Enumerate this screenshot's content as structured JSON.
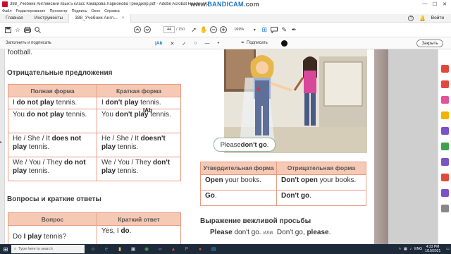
{
  "titlebar": {
    "title": "388_Учебник Английский язык 5 класс Комарова Ларионова Грейджер.pdf - Adobe Acrobat Reader DC",
    "watermark_pre": "www.",
    "watermark_brand": "BANDICAM",
    "watermark_post": ".com",
    "min": "—",
    "max": "☐",
    "close": "✕"
  },
  "menubar": [
    "Файл",
    "Редактирование",
    "Просмотр",
    "Подпись",
    "Окно",
    "Справка"
  ],
  "tabs": {
    "home": "Главная",
    "tools": "Инструменты",
    "doc": "388_Учебник Англ...",
    "doc_close": "×",
    "help": "?",
    "signin": "Войти"
  },
  "toolbar": {
    "page_current": "44",
    "page_total": "/ 150",
    "zoom": "169%"
  },
  "fillsign": {
    "label": "Заполнить и подписать",
    "text_tool": "|Ab",
    "sign_label": "Подписать",
    "close_label": "Закрыть"
  },
  "document": {
    "top_fragment": "football.",
    "negative_heading": "Отрицательные предложения",
    "negative_table": {
      "headers": [
        "Полная форма",
        "Краткая форма"
      ],
      "rows": [
        [
          [
            "I ",
            "do not play",
            " tennis."
          ],
          [
            "I ",
            "don't play",
            " tennis."
          ]
        ],
        [
          [
            "You ",
            "do not play",
            " tennis."
          ],
          [
            "You ",
            "don't play",
            " tennis."
          ]
        ],
        [
          [
            "He / She / It ",
            "does not play",
            " tennis."
          ],
          [
            "He / She / It ",
            "doesn't play",
            " tennis."
          ]
        ],
        [
          [
            "We / You / They ",
            "do not play",
            " tennis."
          ],
          [
            "We / You / They ",
            "don't play",
            " tennis."
          ]
        ]
      ]
    },
    "questions_heading": "Вопросы и краткие ответы",
    "questions_table": {
      "headers": [
        "Вопрос",
        "Краткий ответ"
      ],
      "rows": [
        [
          [
            "Do ",
            "I play",
            " tennis?"
          ],
          [
            "Yes, I ",
            "do",
            "."
          ]
        ]
      ]
    },
    "bubble": {
      "pre": "Please ",
      "bold": "don't go",
      "post": "."
    },
    "imperative_table": {
      "headers": [
        "Утвердительная форма",
        "Отрицательная форма"
      ],
      "rows": [
        [
          [
            "",
            "Open",
            " your books."
          ],
          [
            "",
            "Don't open",
            " your books."
          ]
        ],
        [
          [
            "",
            "Go",
            "."
          ],
          [
            "",
            "Don't go",
            "."
          ]
        ]
      ]
    },
    "polite_heading": "Выражение вежливой просьбы",
    "polite": {
      "a_bold": "Please",
      "a_rest": " don't go.",
      "or": "или",
      "b_rest": " Don't go, ",
      "b_bold": "please",
      "b_end": "."
    },
    "cursor_text": "I̲Ab"
  },
  "taskbar": {
    "search_placeholder": "Type here to search",
    "lang": "ENG",
    "time": "4:23 PM",
    "date": "1/10/2021"
  },
  "colors": {
    "table_header": "#f6c9b5",
    "table_border": "#e89a80",
    "accent_blue": "#1a73c8",
    "taskbar": "#1c2a3a"
  }
}
